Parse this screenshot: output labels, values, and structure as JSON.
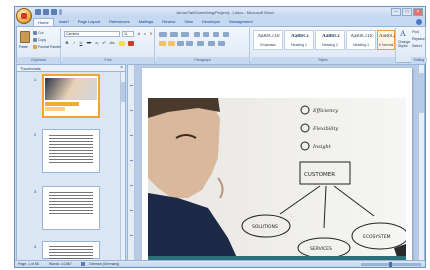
{
  "window": {
    "title": "Arrow/Tail/Something/Project(...).docx - Microsoft Word"
  },
  "tabs": [
    "Home",
    "Insert",
    "Page Layout",
    "References",
    "Mailings",
    "Review",
    "View",
    "Developer",
    "Management"
  ],
  "ribbon": {
    "clipboard": {
      "paste": "Paste",
      "cut": "Cut",
      "copy": "Copy",
      "format_painter": "Format Painter",
      "label": "Clipboard"
    },
    "font": {
      "name": "Cambria",
      "size": "11",
      "label": "Font"
    },
    "paragraph": {
      "label": "Paragraph"
    },
    "styles": {
      "label": "Styles",
      "items": [
        {
          "sample": "AaBbCcDc",
          "name": "Emphasis"
        },
        {
          "sample": "AaBbCc",
          "name": "Heading 1"
        },
        {
          "sample": "AaBbCc",
          "name": "Heading 2"
        },
        {
          "sample": "AaBbCcDc",
          "name": "Heading 3"
        },
        {
          "sample": "AaBbCcDc",
          "name": "K Normal"
        }
      ],
      "change_styles": "Change Styles"
    },
    "editing": {
      "find": "Find",
      "replace": "Replace",
      "select": "Select",
      "label": "Editing"
    }
  },
  "pane": {
    "title": "Thumbnails",
    "pages": [
      "1",
      "2",
      "3",
      "4"
    ]
  },
  "slide": {
    "items": [
      "Efficiency",
      "Flexibility",
      "Insight"
    ],
    "center": "CUSTOMER",
    "nodes": [
      "SOLUTIONS",
      "ECOSYSTEM",
      "SERVICES"
    ]
  },
  "status": {
    "page": "Page: 1 of 65",
    "words": "Words: 14,867",
    "language": "German (Germany)"
  },
  "colors": {
    "accent": "#f1a333",
    "ribbon_bg": "#dce8f6"
  }
}
